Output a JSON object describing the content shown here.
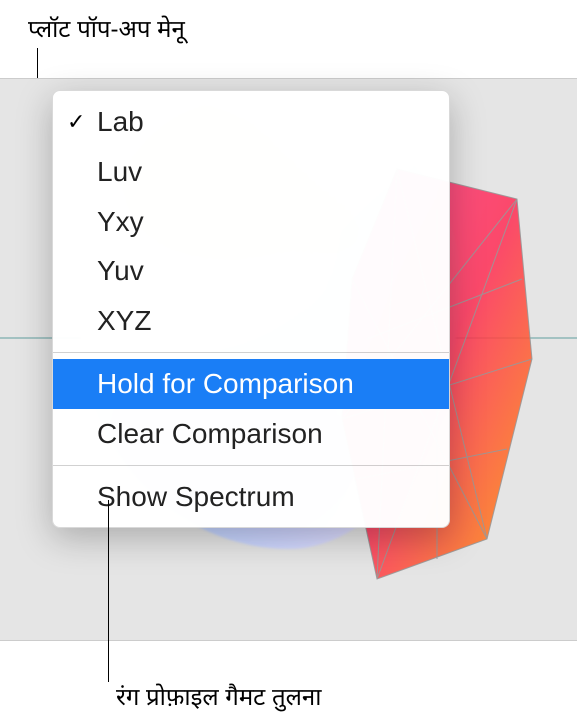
{
  "annotations": {
    "top_label": "प्लॉट पॉप-अप मेनू",
    "bottom_label": "रंग प्रोफ़ाइल गैमट तुलना"
  },
  "menu": {
    "items": [
      {
        "label": "Lab",
        "checked": true,
        "highlighted": false
      },
      {
        "label": "Luv",
        "checked": false,
        "highlighted": false
      },
      {
        "label": "Yxy",
        "checked": false,
        "highlighted": false
      },
      {
        "label": "Yuv",
        "checked": false,
        "highlighted": false
      },
      {
        "label": "XYZ",
        "checked": false,
        "highlighted": false
      }
    ],
    "comparison": {
      "hold": "Hold for Comparison",
      "clear": "Clear Comparison"
    },
    "spectrum": {
      "show": "Show Spectrum"
    }
  }
}
